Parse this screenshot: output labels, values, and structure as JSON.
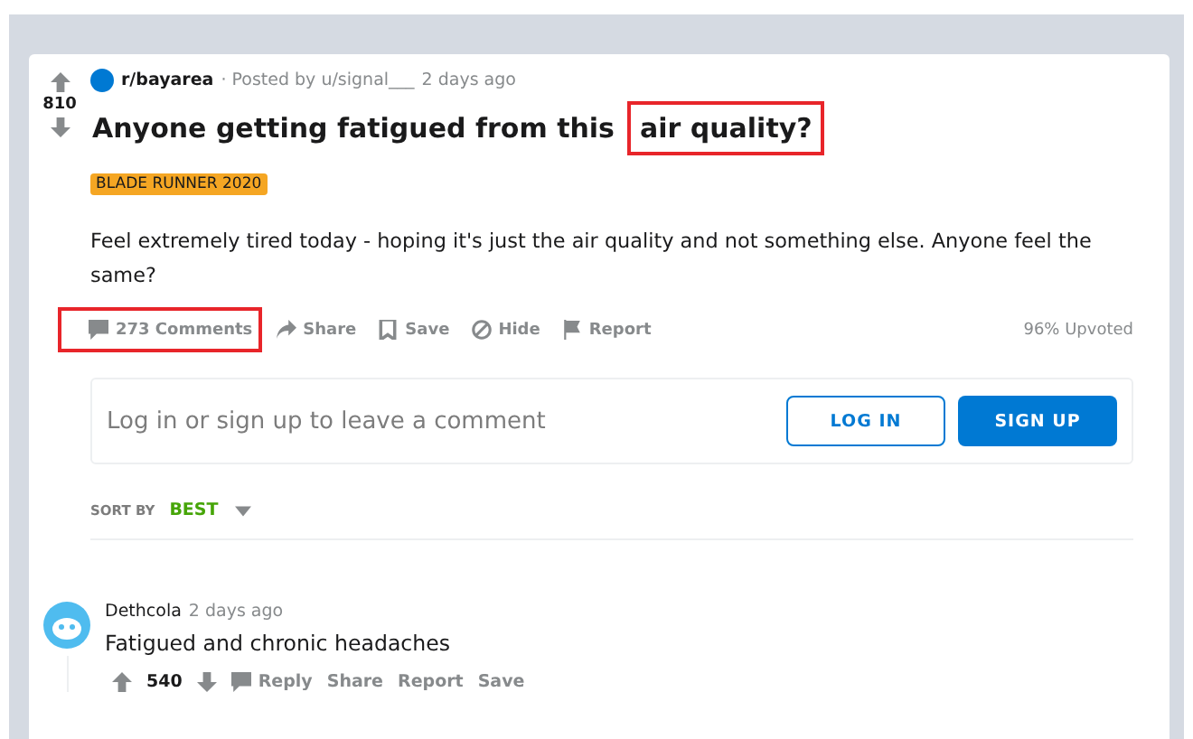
{
  "post": {
    "votes": "810",
    "subreddit": "r/bayarea",
    "posted_by": "· Posted by u/signal___",
    "time": "2 days ago",
    "title_parts": [
      {
        "text": "Anyone getting fatigued from this",
        "highlighted": false
      },
      {
        "text": "air quality?",
        "highlighted": true
      }
    ],
    "flair": "BLADE RUNNER 2020",
    "body": "Feel extremely tired today - hoping it's just the air quality and not something else. Anyone feel the same?",
    "actions": [
      {
        "kind": "comments",
        "label": "273 Comments",
        "highlighted": true
      },
      {
        "kind": "share",
        "label": "Share",
        "highlighted": false
      },
      {
        "kind": "save",
        "label": "Save",
        "highlighted": false
      },
      {
        "kind": "hide",
        "label": "Hide",
        "highlighted": false
      },
      {
        "kind": "report",
        "label": "Report",
        "highlighted": false
      }
    ],
    "upvoted": "96% Upvoted"
  },
  "login_prompt": {
    "text": "Log in or sign up to leave a comment",
    "buttons": [
      {
        "kind": "outline",
        "label": "LOG IN"
      },
      {
        "kind": "filled",
        "label": "SIGN UP"
      }
    ]
  },
  "sort": {
    "label": "SORT BY",
    "value": "BEST"
  },
  "comments": [
    {
      "author": "Dethcola",
      "time": "2 days ago",
      "text": "Fatigued and chronic headaches",
      "votes": "540",
      "actions": [
        "Reply",
        "Share",
        "Report",
        "Save"
      ]
    }
  ]
}
